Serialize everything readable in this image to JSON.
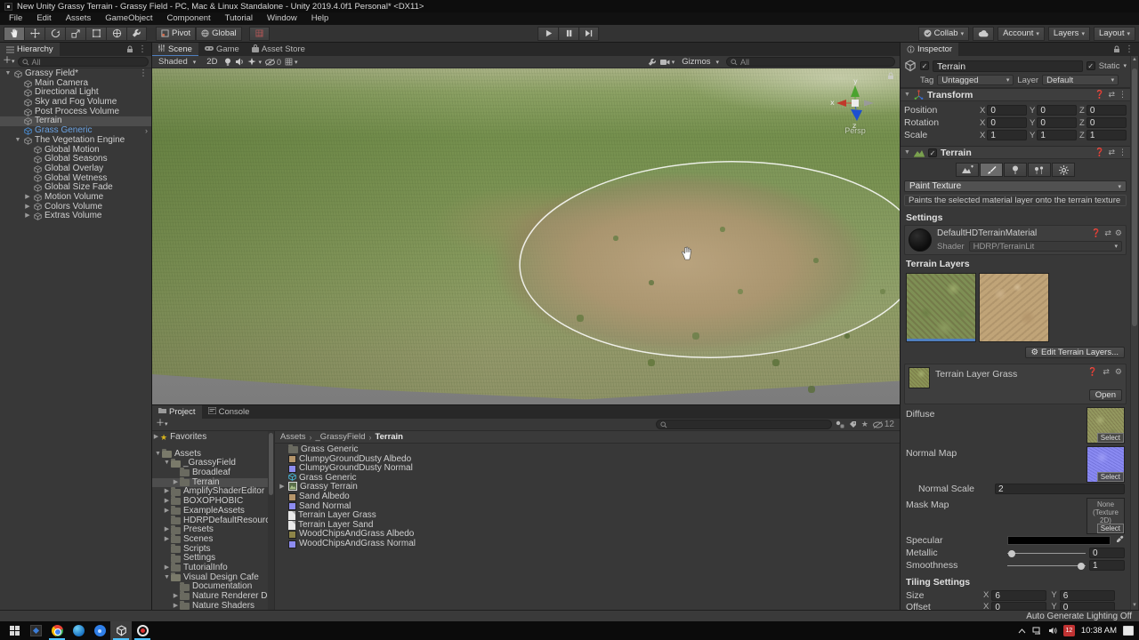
{
  "window": {
    "title": "New Unity Grassy Terrain - Grassy Field - PC, Mac & Linux Standalone - Unity 2019.4.0f1 Personal* <DX11>",
    "menus": [
      "File",
      "Edit",
      "Assets",
      "GameObject",
      "Component",
      "Tutorial",
      "Window",
      "Help"
    ]
  },
  "toolbar": {
    "pivot_label": "Pivot",
    "global_label": "Global",
    "collab_label": "Collab",
    "account_label": "Account",
    "layers_label": "Layers",
    "layout_label": "Layout"
  },
  "hierarchy": {
    "tab": "Hierarchy",
    "search_text": "All",
    "items": [
      {
        "label": "Grassy Field*",
        "type": "scene",
        "expand": "open",
        "indent": 0,
        "menu_dots": true
      },
      {
        "label": "Main Camera",
        "type": "go",
        "indent": 1
      },
      {
        "label": "Directional Light",
        "type": "go",
        "indent": 1
      },
      {
        "label": "Sky and Fog Volume",
        "type": "go",
        "indent": 1
      },
      {
        "label": "Post Process Volume",
        "type": "go",
        "indent": 1
      },
      {
        "label": "Terrain",
        "type": "go",
        "indent": 1,
        "selected": true
      },
      {
        "label": "Grass Generic",
        "type": "prefab",
        "indent": 1,
        "arrow": true
      },
      {
        "label": "The Vegetation Engine",
        "type": "go",
        "indent": 1,
        "expand": "open"
      },
      {
        "label": "Global Motion",
        "type": "go",
        "indent": 2
      },
      {
        "label": "Global Seasons",
        "type": "go",
        "indent": 2
      },
      {
        "label": "Global Overlay",
        "type": "go",
        "indent": 2
      },
      {
        "label": "Global Wetness",
        "type": "go",
        "indent": 2
      },
      {
        "label": "Global Size Fade",
        "type": "go",
        "indent": 2
      },
      {
        "label": "Motion Volume",
        "type": "go",
        "indent": 2,
        "expand": "closed"
      },
      {
        "label": "Colors Volume",
        "type": "go",
        "indent": 2,
        "expand": "closed"
      },
      {
        "label": "Extras Volume",
        "type": "go",
        "indent": 2,
        "expand": "closed"
      }
    ]
  },
  "scene": {
    "tabs": [
      "Scene",
      "Game",
      "Asset Store"
    ],
    "active_tab": "Scene",
    "shading_mode": "Shaded",
    "mode_2d": "2D",
    "hidden_count": "0",
    "gizmos_label": "Gizmos",
    "search_text": "All",
    "persp_label": "Persp",
    "axis_labels": {
      "x": "x",
      "y": "y",
      "z": "z"
    }
  },
  "project": {
    "tabs": [
      "Project",
      "Console"
    ],
    "active_tab": "Project",
    "favorites_label": "Favorites",
    "tree": [
      {
        "label": "Assets",
        "indent": 0,
        "expand": "open",
        "open": true
      },
      {
        "label": "_GrassyField",
        "indent": 1,
        "expand": "open",
        "open": true
      },
      {
        "label": "Broadleaf",
        "indent": 2
      },
      {
        "label": "Terrain",
        "indent": 2,
        "expand": "closed",
        "selected": true
      },
      {
        "label": "AmplifyShaderEditor",
        "indent": 1,
        "expand": "closed"
      },
      {
        "label": "BOXOPHOBIC",
        "indent": 1,
        "expand": "closed"
      },
      {
        "label": "ExampleAssets",
        "indent": 1,
        "expand": "closed"
      },
      {
        "label": "HDRPDefaultResources",
        "indent": 1
      },
      {
        "label": "Presets",
        "indent": 1,
        "expand": "closed"
      },
      {
        "label": "Scenes",
        "indent": 1,
        "expand": "closed"
      },
      {
        "label": "Scripts",
        "indent": 1
      },
      {
        "label": "Settings",
        "indent": 1
      },
      {
        "label": "TutorialInfo",
        "indent": 1,
        "expand": "closed"
      },
      {
        "label": "Visual Design Cafe",
        "indent": 1,
        "expand": "open",
        "open": true
      },
      {
        "label": "Documentation",
        "indent": 2
      },
      {
        "label": "Nature Renderer Demo",
        "indent": 2,
        "expand": "closed"
      },
      {
        "label": "Nature Shaders",
        "indent": 2,
        "expand": "closed"
      }
    ],
    "breadcrumb": [
      "Assets",
      "_GrassyField",
      "Terrain"
    ],
    "files": [
      {
        "label": "Grass Generic",
        "icon": "folder"
      },
      {
        "label": "ClumpyGroundDusty Albedo",
        "icon": "tex-tan"
      },
      {
        "label": "ClumpyGroundDusty Normal",
        "icon": "tex-purple"
      },
      {
        "label": "Grass Generic",
        "icon": "prefab"
      },
      {
        "label": "Grassy Terrain",
        "icon": "terrain",
        "expand": "closed"
      },
      {
        "label": "Sand Albedo",
        "icon": "tex-tan"
      },
      {
        "label": "Sand Normal",
        "icon": "tex-purple"
      },
      {
        "label": "Terrain Layer Grass",
        "icon": "doc"
      },
      {
        "label": "Terrain Layer Sand",
        "icon": "doc"
      },
      {
        "label": "WoodChipsAndGrass Albedo",
        "icon": "tex-olive"
      },
      {
        "label": "WoodChipsAndGrass Normal",
        "icon": "tex-purple"
      }
    ],
    "hidden_count": "12"
  },
  "inspector": {
    "tab": "Inspector",
    "header": {
      "name": "Terrain",
      "static_label": "Static",
      "tag_label": "Tag",
      "tag_value": "Untagged",
      "layer_label": "Layer",
      "layer_value": "Default"
    },
    "axis_labels": {
      "x": "X",
      "y": "Y",
      "z": "Z"
    },
    "transform": {
      "title": "Transform",
      "rows": [
        {
          "label": "Position",
          "x": "0",
          "y": "0",
          "z": "0"
        },
        {
          "label": "Rotation",
          "x": "0",
          "y": "0",
          "z": "0"
        },
        {
          "label": "Scale",
          "x": "1",
          "y": "1",
          "z": "1"
        }
      ]
    },
    "terrain": {
      "title": "Terrain",
      "tool_dropdown": "Paint Texture",
      "tool_help": "Paints the selected material layer onto the terrain texture",
      "settings_label": "Settings",
      "material_name": "DefaultHDTerrainMaterial",
      "shader_label": "Shader",
      "shader_value": "HDRP/TerrainLit",
      "terrain_layers_label": "Terrain Layers",
      "edit_layers_button": "Edit Terrain Layers...",
      "layer": {
        "name": "Terrain Layer Grass",
        "open_button": "Open",
        "diffuse_label": "Diffuse",
        "normal_map_label": "Normal Map",
        "normal_scale_label": "Normal Scale",
        "normal_scale_value": "2",
        "mask_map_label": "Mask Map",
        "mask_map_value": "None (Texture 2D)",
        "select_button": "Select",
        "specular_label": "Specular",
        "metallic_label": "Metallic",
        "metallic_value": "0",
        "smoothness_label": "Smoothness",
        "smoothness_value": "1",
        "tiling_label": "Tiling Settings",
        "size_label": "Size",
        "size_x": "6",
        "size_y": "6",
        "offset_label": "Offset",
        "offset_x": "0",
        "offset_y": "0"
      }
    }
  },
  "statusbar": {
    "auto_generate_lighting": "Auto Generate Lighting Off"
  },
  "taskbar": {
    "time": "10:38 AM",
    "date_badge": "12"
  }
}
